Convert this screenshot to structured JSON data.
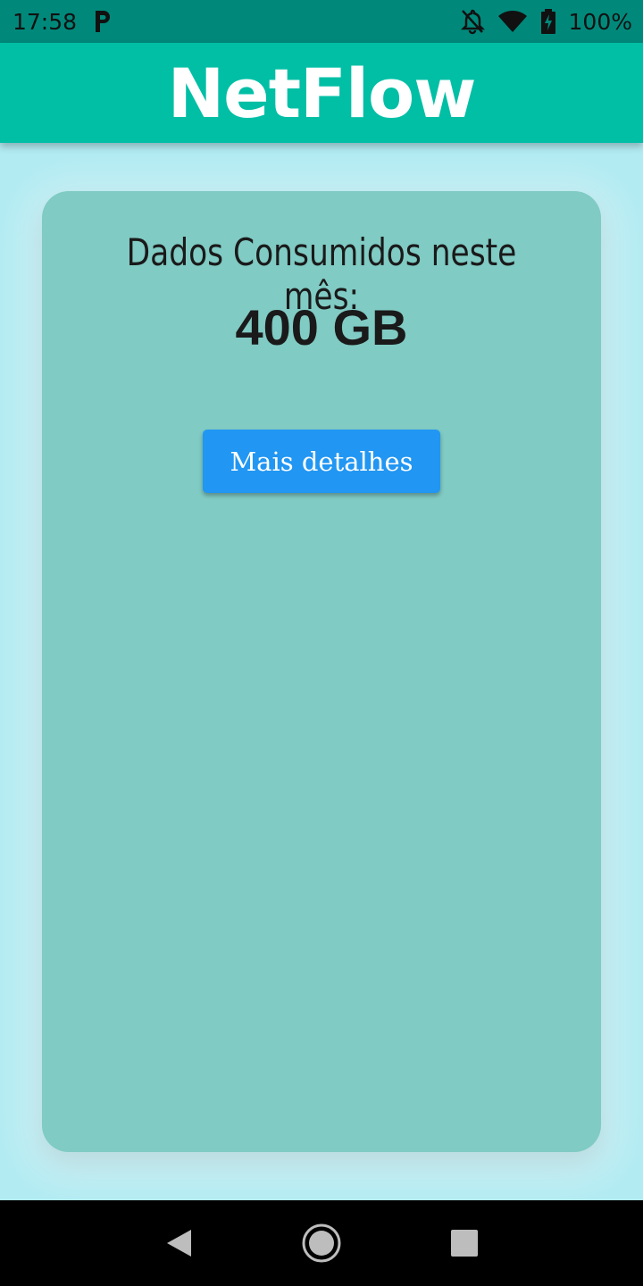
{
  "status_bar": {
    "time": "17:58",
    "battery": "100%",
    "icons": [
      "parking-icon",
      "bell-off-icon",
      "wifi-icon",
      "battery-charging-icon"
    ]
  },
  "app_bar": {
    "title": "NetFlow"
  },
  "card": {
    "label": "Dados Consumidos neste mês:",
    "value": "400 GB",
    "button_label": "Mais detalhes"
  },
  "nav_bar": {
    "icons": [
      "back-icon",
      "home-icon",
      "recents-icon"
    ]
  },
  "colors": {
    "status_bar": "#00897b",
    "app_bar": "#00bfa5",
    "background": "#b2ebf2",
    "card": "#80cbc4",
    "button": "#2196f3"
  }
}
